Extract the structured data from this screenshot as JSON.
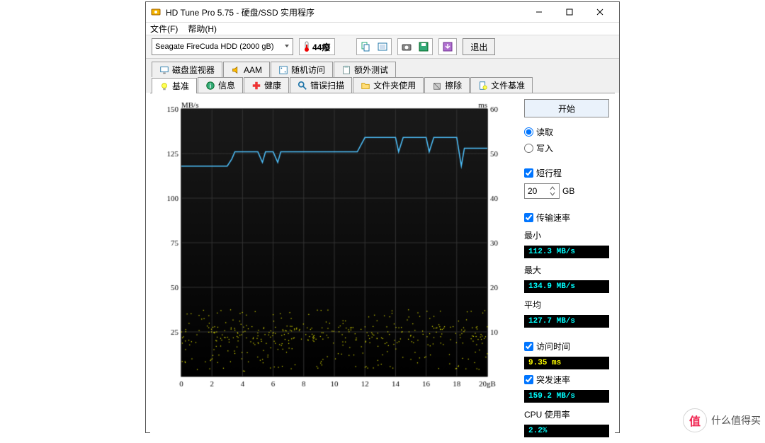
{
  "window": {
    "title": "HD Tune Pro 5.75 - 硬盘/SSD 实用程序"
  },
  "menu": {
    "file": "文件(F)",
    "help": "帮助(H)"
  },
  "toolbar": {
    "drive": "Seagate FireCuda HDD (2000 gB)",
    "temperature": "44癈",
    "exit_label": "退出"
  },
  "tabs_top": [
    {
      "label": "磁盘监视器",
      "icon": "monitor"
    },
    {
      "label": "AAM",
      "icon": "speaker"
    },
    {
      "label": "随机访问",
      "icon": "random"
    },
    {
      "label": "额外测试",
      "icon": "clipboard"
    }
  ],
  "tabs_bottom": [
    {
      "label": "基准",
      "icon": "bulb",
      "active": true
    },
    {
      "label": "信息",
      "icon": "info"
    },
    {
      "label": "健康",
      "icon": "health"
    },
    {
      "label": "错误扫描",
      "icon": "scan"
    },
    {
      "label": "文件夹使用",
      "icon": "folder"
    },
    {
      "label": "擦除",
      "icon": "erase"
    },
    {
      "label": "文件基准",
      "icon": "filebench"
    }
  ],
  "sidebar": {
    "start_label": "开始",
    "read_label": "读取",
    "write_label": "写入",
    "stroke_label": "短行程",
    "stroke_value": "20",
    "gb_unit": "GB",
    "transfer_label": "传输速率",
    "min_label": "最小",
    "min_value": "112.3 MB/s",
    "max_label": "最大",
    "max_value": "134.9 MB/s",
    "avg_label": "平均",
    "avg_value": "127.7 MB/s",
    "access_label": "访问时间",
    "access_value": "9.35 ms",
    "burst_label": "突发速率",
    "burst_value": "159.2 MB/s",
    "cpu_label": "CPU 使用率",
    "cpu_value": "2.2%"
  },
  "chart_data": {
    "type": "line",
    "left_unit": "MB/s",
    "right_unit": "ms",
    "x_unit": "gB",
    "x_range": [
      0,
      20
    ],
    "left_range": [
      0,
      150
    ],
    "right_range": [
      0,
      60
    ],
    "x_ticks": [
      0,
      2,
      4,
      6,
      8,
      10,
      12,
      14,
      16,
      18,
      20
    ],
    "left_ticks": [
      25,
      50,
      75,
      100,
      125,
      150
    ],
    "right_ticks": [
      10,
      20,
      30,
      40,
      50,
      60
    ],
    "transfer_series": {
      "name": "transfer",
      "color": "#4fc3ff",
      "x": [
        0.0,
        0.5,
        1.0,
        1.5,
        2.0,
        2.5,
        3.0,
        3.3,
        3.5,
        4.0,
        4.5,
        5.0,
        5.3,
        5.5,
        6.0,
        6.3,
        6.5,
        7.0,
        7.5,
        8.0,
        8.5,
        9.0,
        9.5,
        10.0,
        10.5,
        11.0,
        11.5,
        12.0,
        12.5,
        13.0,
        13.5,
        14.0,
        14.2,
        14.5,
        15.0,
        15.5,
        16.0,
        16.2,
        16.5,
        17.0,
        17.5,
        18.0,
        18.3,
        18.5,
        19.0,
        19.5,
        20.0
      ],
      "values": [
        118,
        118,
        118,
        118,
        118,
        118,
        118,
        122,
        126,
        126,
        126,
        126,
        120,
        126,
        126,
        120,
        126,
        126,
        126,
        126,
        126,
        126,
        126,
        126,
        126,
        126,
        126,
        134,
        134,
        134,
        134,
        134,
        126,
        134,
        134,
        134,
        134,
        126,
        134,
        134,
        134,
        134,
        118,
        128,
        128,
        128,
        128
      ]
    },
    "access_scatter": {
      "name": "access_time",
      "color": "#e6e600",
      "count": 420,
      "y_min": 1,
      "y_max": 15,
      "y_mean": 9.35
    }
  },
  "watermark": {
    "badge": "值",
    "text": "什么值得买"
  }
}
